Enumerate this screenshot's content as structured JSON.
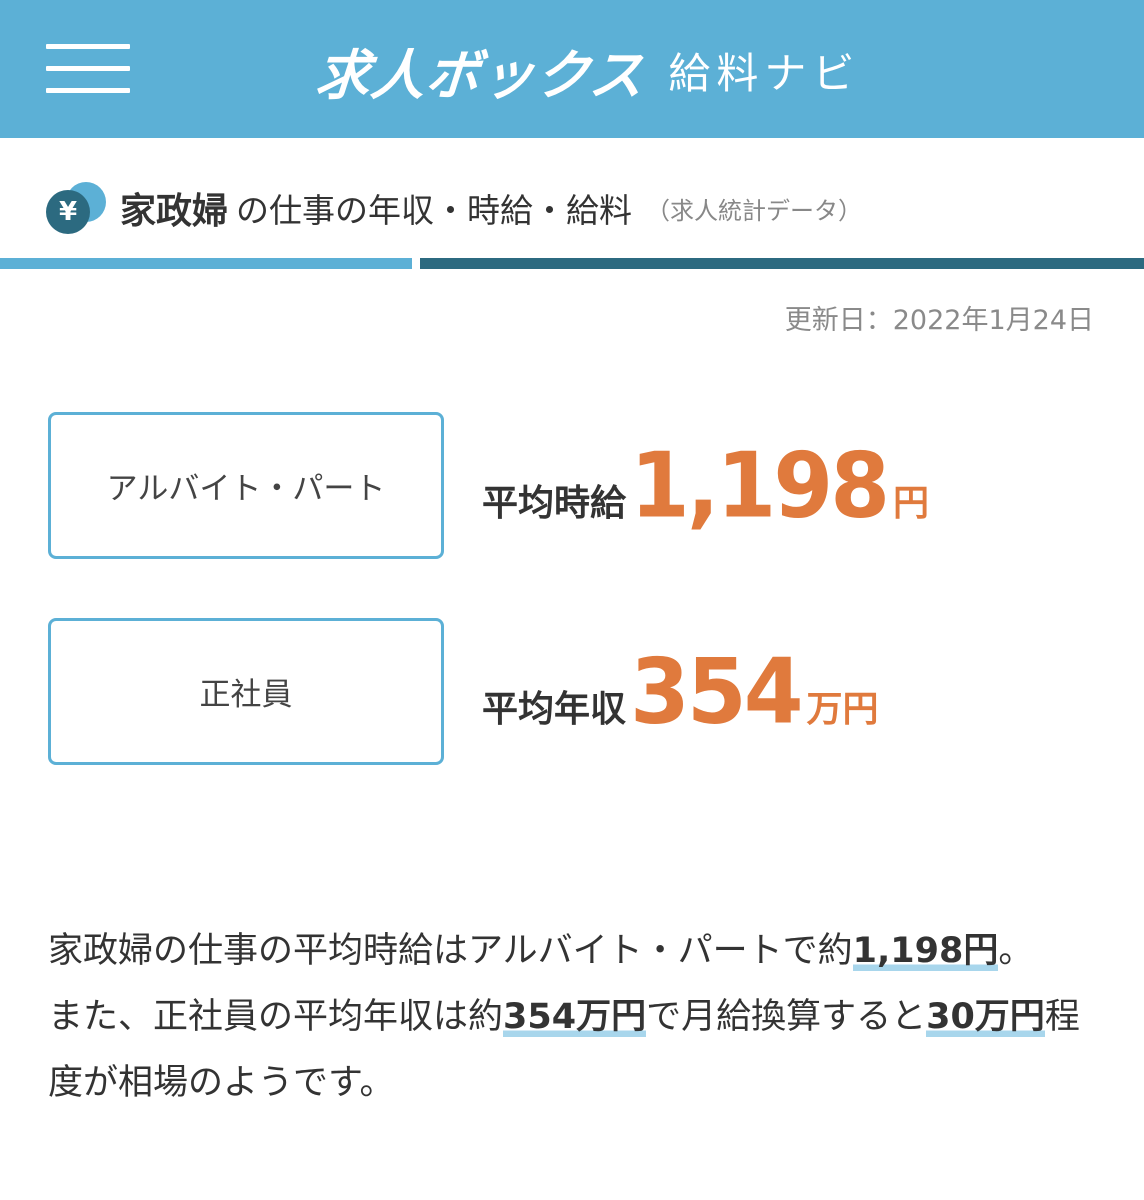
{
  "header": {
    "logo_main": "求人ボックス",
    "logo_sub": "給料ナビ"
  },
  "title": {
    "icon_symbol": "¥",
    "job": "家政婦",
    "rest": "の仕事の年収・時給・給料",
    "note": "（求人統計データ）"
  },
  "updated": "更新日：2022年1月24日",
  "salaries": [
    {
      "type": "アルバイト・パート",
      "label": "平均時給",
      "value": "1,198",
      "unit": "円"
    },
    {
      "type": "正社員",
      "label": "平均年収",
      "value": "354",
      "unit": "万円"
    }
  ],
  "paragraph": {
    "s1": "家政婦の仕事の平均時給はアルバイト・パートで約",
    "s1_hl": "1,198円",
    "s1_end": "。",
    "s2": "また、正社員の平均年収は約",
    "s2_hl": "354万円",
    "s2_mid": "で月給換算すると",
    "s2_hl2": "30万円",
    "s2_end": "程度が相場のようです。"
  },
  "colors": {
    "header_bg": "#5cb0d6",
    "accent_dark": "#2c6a80",
    "salary_orange": "#e07a3d",
    "highlight": "#a8d6ec"
  }
}
